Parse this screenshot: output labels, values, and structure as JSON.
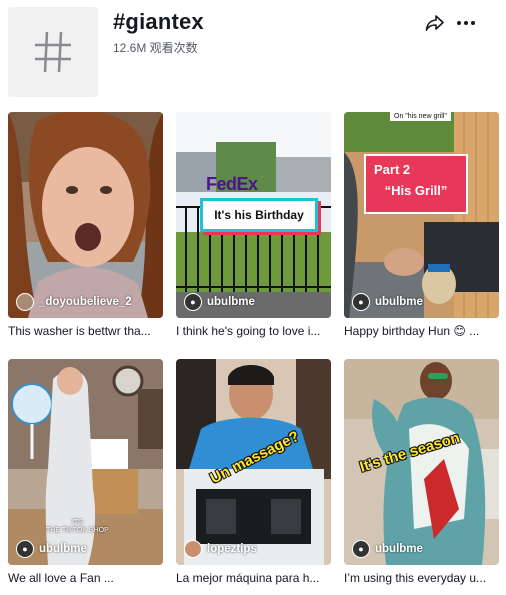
{
  "hashtag": {
    "title": "#giantex",
    "views": "12.6M 观看次数"
  },
  "videos": [
    {
      "author": "_doyoubelieve_2",
      "caption": "This washer is bettwr tha..."
    },
    {
      "author": "ubulbme",
      "caption": "I think he's going to love i...",
      "overlay": [
        "FedEx",
        "It's his Birthday"
      ]
    },
    {
      "author": "ubulbme",
      "caption": "Happy birthday Hun 😊 ...",
      "overlay": [
        "On \"his new grill\"",
        "Part 2",
        "“His Grill”"
      ]
    },
    {
      "author": "ubulbme",
      "caption": "We all love a Fan ...",
      "overlay": [
        "ITS",
        "THE TIKTOK SHOP"
      ]
    },
    {
      "author": "lopeztips",
      "caption": "La mejor máquina para h...",
      "overlay": [
        "Un massage?"
      ]
    },
    {
      "author": "ubulbme",
      "caption": "I’m using this everyday u...",
      "overlay": [
        "It's the season"
      ]
    }
  ]
}
